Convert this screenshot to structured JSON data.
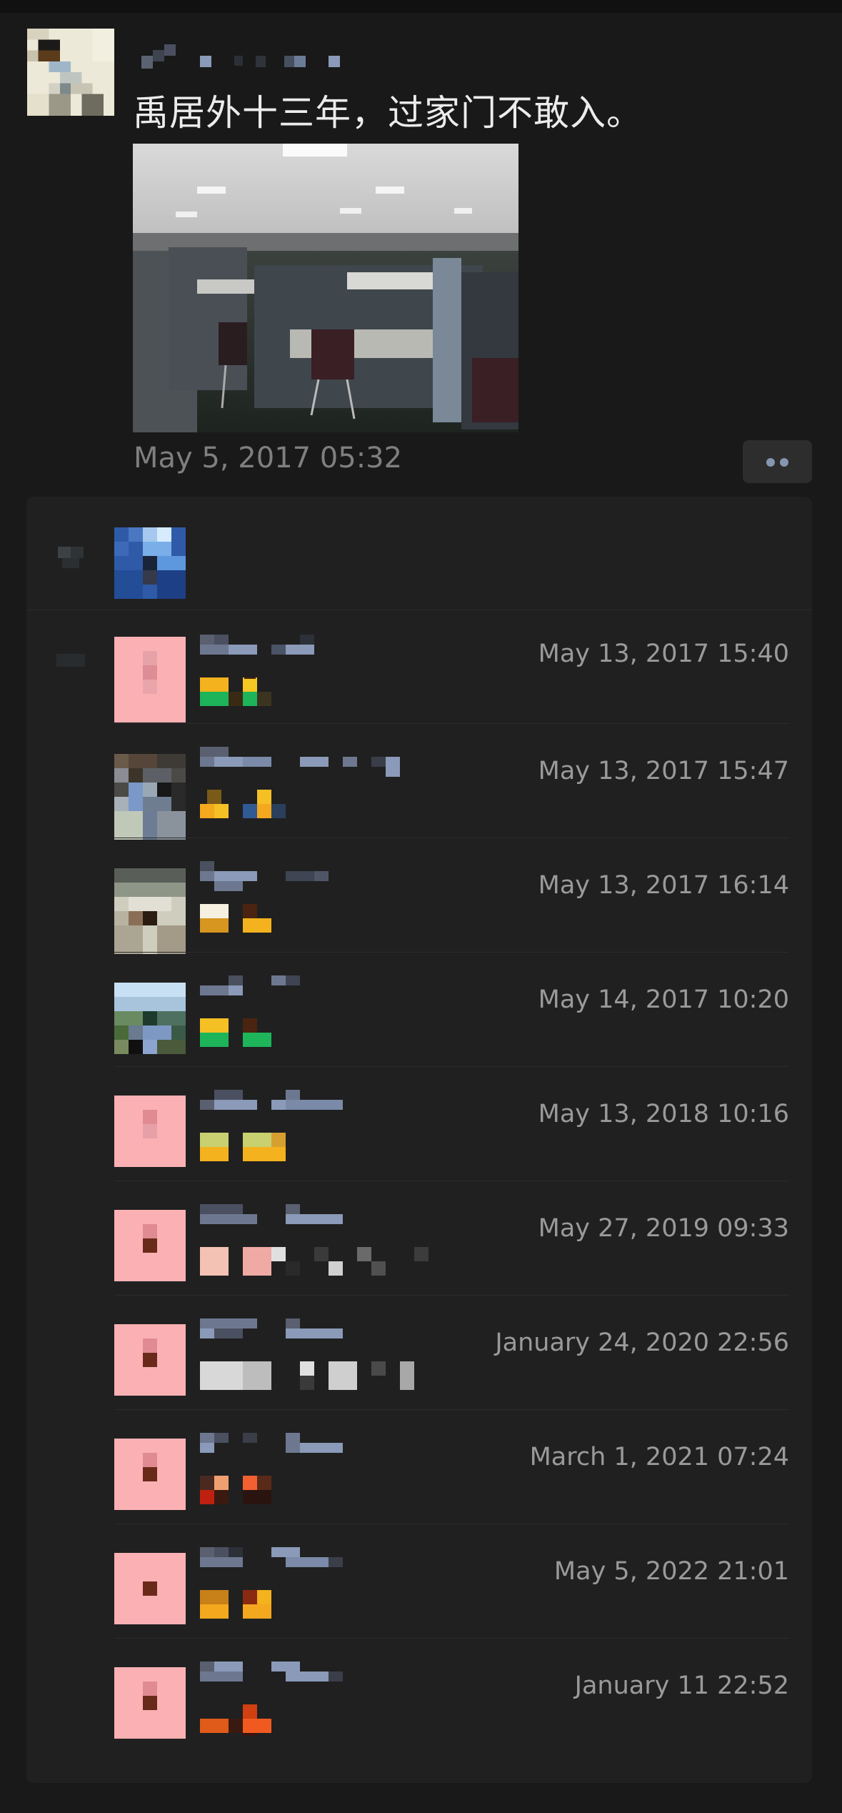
{
  "post": {
    "text": "禹居外十三年，过家门不敢入。",
    "time": "May 5, 2017 05:32"
  },
  "comments": [
    {
      "time": "May 13, 2017 15:40"
    },
    {
      "time": "May 13, 2017 15:47"
    },
    {
      "time": "May 13, 2017 16:14"
    },
    {
      "time": "May 14, 2017 10:20"
    },
    {
      "time": "May 13, 2018 10:16"
    },
    {
      "time": "May 27, 2019 09:33"
    },
    {
      "time": "January 24, 2020 22:56"
    },
    {
      "time": "March 1, 2021 07:24"
    },
    {
      "time": "May 5, 2022 21:01"
    },
    {
      "time": "January 11 22:52"
    }
  ],
  "colors": {
    "background": "#191919",
    "panel": "#202020",
    "time_text": "#9a9a9a",
    "name_blur": "#8a9ab8",
    "pink_avatar": "#fbb1b4",
    "more_dots": "#8596b0"
  },
  "icons": {
    "more": "more-dots-icon",
    "like": "heart-icon",
    "comment": "comment-icon"
  }
}
